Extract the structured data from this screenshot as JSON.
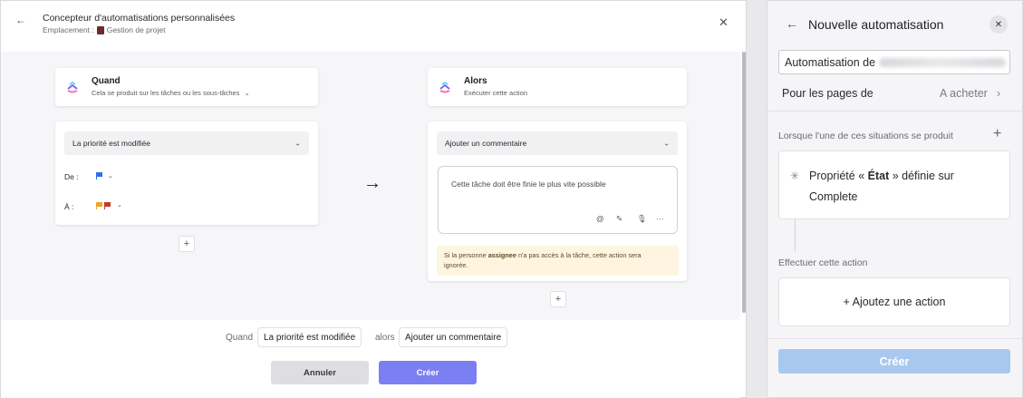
{
  "left_panel": {
    "title": "Concepteur d'automatisations personnalisées",
    "breadcrumb_label": "Emplacement :",
    "breadcrumb_value": "Gestion de projet",
    "back_icon": "←",
    "close_icon": "✕"
  },
  "when_card": {
    "title": "Quand",
    "subtitle": "Cela se produit sur les tâches ou les sous-tâches",
    "dropdown_value": "La priorité est modifiée",
    "from_label": "De :",
    "to_label": "À :",
    "from_flag_color": "#2f6fe8",
    "to_flag_colors": [
      "#e8a824",
      "#c23a2a"
    ]
  },
  "then_card": {
    "title": "Alors",
    "subtitle": "Exécuter cette action",
    "dropdown_value": "Ajouter un commentaire",
    "comment_text": "Cette tâche doit être finie le plus vite possible",
    "warning_prefix": "Si la personne",
    "warning_bold": "assignee",
    "warning_suffix": "n'a pas accès à la tâche, cette action sera",
    "warning_line2": "ignorée."
  },
  "arrow_glyph": "→",
  "plus_glyph": "+",
  "summary": {
    "when_word": "Quand",
    "trigger_chip": "La priorité est modifiée",
    "then_word": "alors",
    "action_chip": "Ajouter un commentaire"
  },
  "buttons": {
    "cancel": "Annuler",
    "create": "Créer"
  },
  "right_panel": {
    "title": "Nouvelle automatisation",
    "name_prefix": "Automatisation de",
    "pages_label": "Pour les pages de",
    "pages_value": "A acheter",
    "trigger_section": "Lorsque l'une de ces situations se produit",
    "trigger_line1_pre": "Propriété « ",
    "trigger_line1_bold": "État",
    "trigger_line1_post": " » définie sur",
    "trigger_line2": "Complete",
    "action_section": "Effectuer cette action",
    "add_action": "+ Ajoutez une action",
    "create_button": "Créer"
  },
  "colors": {
    "accent": "#7c7ff2",
    "create_disabled": "#a9c8f0",
    "warning_bg": "#fdf5df"
  }
}
